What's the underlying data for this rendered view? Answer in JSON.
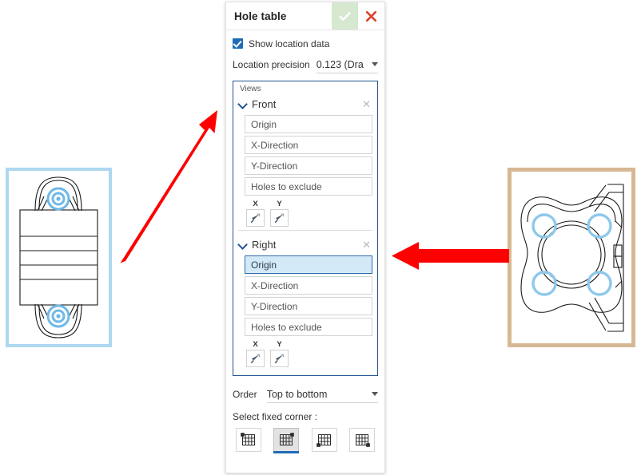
{
  "dialog": {
    "title": "Hole table",
    "ok_icon": "check-icon",
    "cancel_icon": "close-icon",
    "show_location_data": {
      "label": "Show location data",
      "checked": true
    },
    "location_precision": {
      "label": "Location precision",
      "value": "0.123 (Dra"
    },
    "views_group": {
      "legend": "Views",
      "views": [
        {
          "name": "Front",
          "close_icon": "close-icon",
          "chevron_icon": "chevron-down-icon",
          "fields": [
            {
              "label": "Origin",
              "selected": false
            },
            {
              "label": "X-Direction",
              "selected": false
            },
            {
              "label": "Y-Direction",
              "selected": false
            },
            {
              "label": "Holes to exclude",
              "selected": false
            }
          ],
          "flip": [
            {
              "axis": "X",
              "icon": "flip-direction-icon"
            },
            {
              "axis": "Y",
              "icon": "flip-direction-icon"
            }
          ]
        },
        {
          "name": "Right",
          "close_icon": "close-icon",
          "chevron_icon": "chevron-down-icon",
          "fields": [
            {
              "label": "Origin",
              "selected": true
            },
            {
              "label": "X-Direction",
              "selected": false
            },
            {
              "label": "Y-Direction",
              "selected": false
            },
            {
              "label": "Holes to exclude",
              "selected": false
            }
          ],
          "flip": [
            {
              "axis": "X",
              "icon": "flip-direction-icon"
            },
            {
              "axis": "Y",
              "icon": "flip-direction-icon"
            }
          ]
        }
      ]
    },
    "order": {
      "label": "Order",
      "value": "Top to bottom"
    },
    "fixed_corner": {
      "label": "Select fixed corner :",
      "options": [
        {
          "name": "top-left",
          "active": false
        },
        {
          "name": "top-right",
          "active": true
        },
        {
          "name": "bottom-left",
          "active": false
        },
        {
          "name": "bottom-right",
          "active": false
        }
      ]
    }
  },
  "views_preview": {
    "front": {
      "name": "Front view",
      "border_color": "#aed8f0",
      "hole_color": "#6fb8e8"
    },
    "right": {
      "name": "Right view",
      "border_color": "#d6b894",
      "hole_color": "#8ec8ea"
    }
  },
  "annotations": {
    "arrow_color": "#ff0000",
    "arrows": [
      {
        "name": "arrow-front-to-dialog",
        "from": [
          150,
          328
        ],
        "to": [
          272,
          138
        ]
      },
      {
        "name": "arrow-right-to-dialog",
        "from": [
          637,
          320
        ],
        "to": [
          490,
          320
        ]
      }
    ]
  }
}
